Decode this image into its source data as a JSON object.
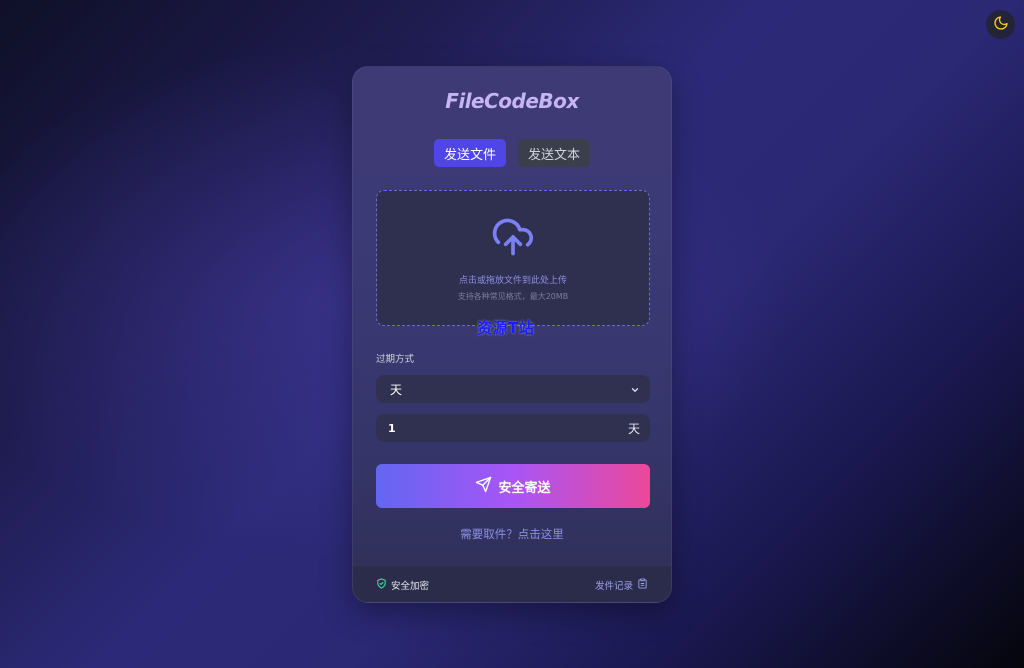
{
  "app": {
    "logo_text": "FileCodeBox",
    "theme_icon": "moon-icon"
  },
  "tabs": [
    {
      "label": "发送文件",
      "active": true
    },
    {
      "label": "发送文本",
      "active": false
    }
  ],
  "upload": {
    "icon": "cloud-upload-icon",
    "title": "点击或拖放文件到此处上传",
    "subtitle": "支持各种常见格式，最大20MB"
  },
  "watermark": "资源T站",
  "expiry": {
    "label": "过期方式",
    "method_value": "天",
    "amount_value": "1",
    "amount_unit": "天"
  },
  "submit": {
    "label": "安全寄送",
    "icon": "send-icon"
  },
  "retrieve_link": "需要取件？点击这里",
  "footer": {
    "secure_label": "安全加密",
    "secure_icon": "shield-check-icon",
    "history_label": "发件记录",
    "history_icon": "clipboard-icon"
  },
  "colors": {
    "accent": "#4f46e5",
    "gradient_start": "#6366f1",
    "gradient_end": "#ec4899",
    "moon": "#facc15",
    "secure_green": "#34d399"
  }
}
